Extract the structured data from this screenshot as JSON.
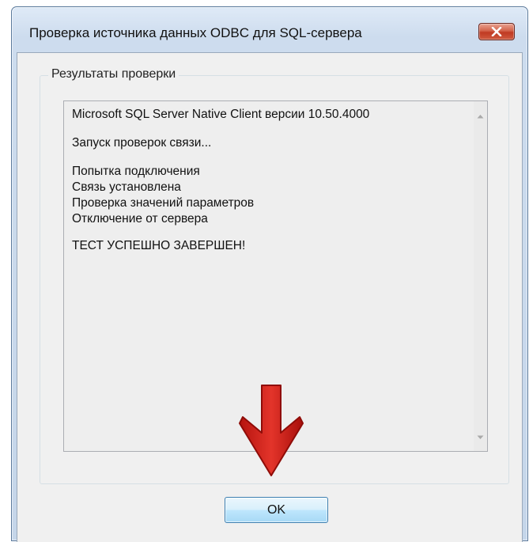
{
  "window": {
    "title": "Проверка источника данных ODBC для SQL-сервера",
    "close_icon": "close-icon"
  },
  "group": {
    "label": "Результаты проверки"
  },
  "results": {
    "lines": [
      "Microsoft SQL Server Native Client версии 10.50.4000",
      "Запуск проверок связи...",
      "Попытка подключения",
      "Связь установлена",
      "Проверка значений параметров",
      "Отключение от сервера",
      "ТЕСТ УСПЕШНО ЗАВЕРШЕН!"
    ]
  },
  "buttons": {
    "ok_label": "OK"
  },
  "annotation": {
    "arrow_icon": "red-down-arrow-icon",
    "arrow_color": "#d9261c"
  },
  "colors": {
    "titlebar": "#cddcee",
    "client": "#f0f0f0",
    "close_button": "#c8452d",
    "ok_button_border": "#3c7fb1"
  }
}
